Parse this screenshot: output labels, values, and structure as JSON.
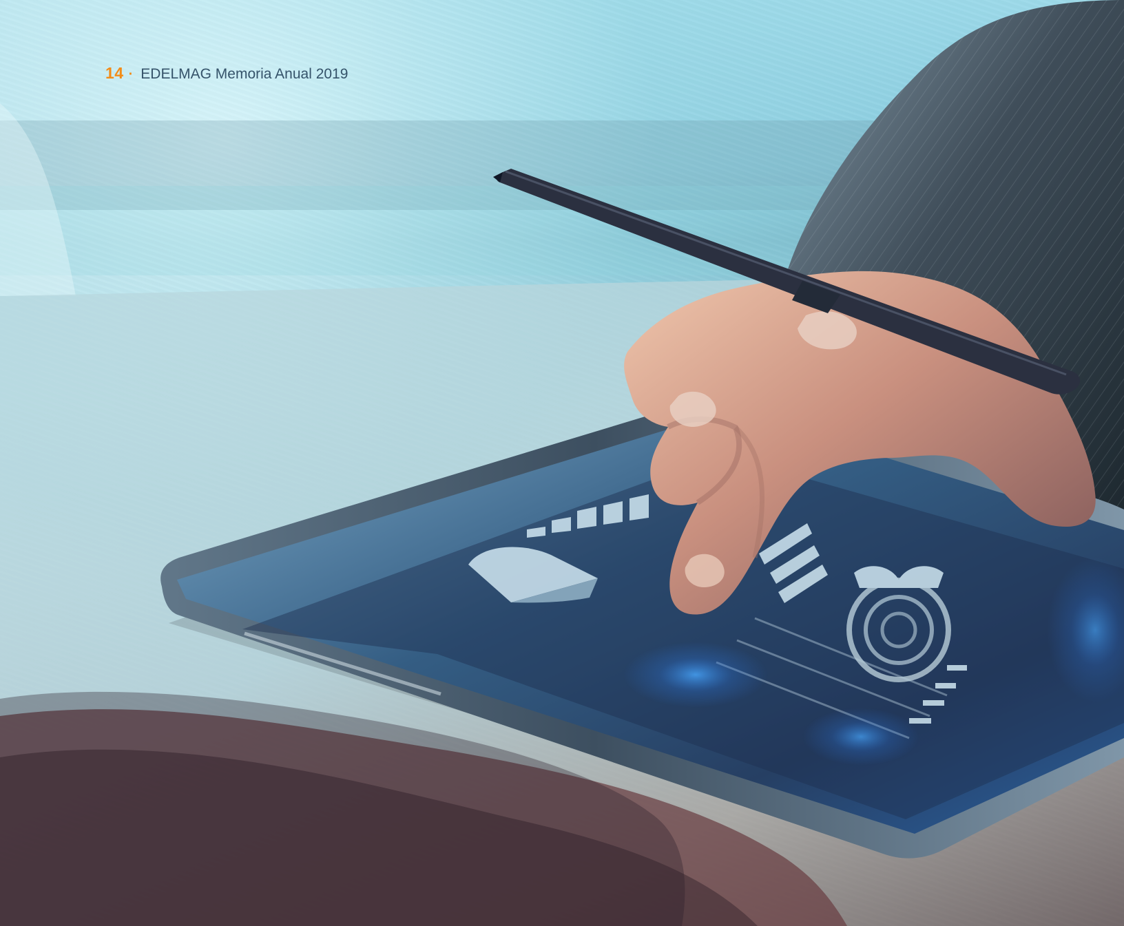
{
  "header": {
    "page_number": "14",
    "separator": "·",
    "publication_title": "EDELMAG Memoria Anual 2019"
  },
  "colors": {
    "accent": "#f28c18",
    "title_text": "#35536a",
    "background_cyan": "#8fd0e1"
  },
  "image": {
    "icon": "tablet-stylus-business-photo-icon"
  }
}
